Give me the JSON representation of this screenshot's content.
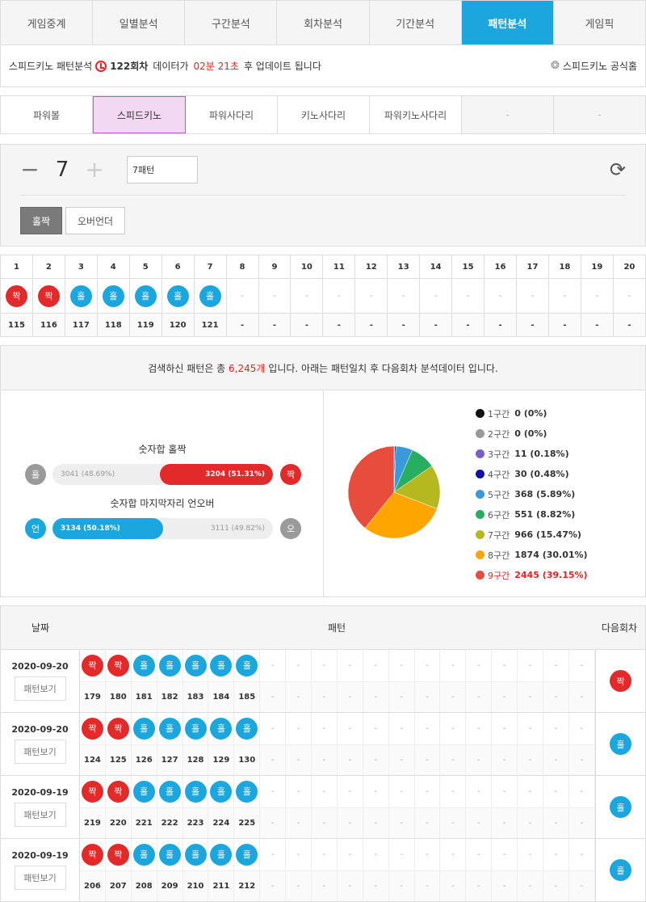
{
  "top_tabs": [
    "게임중계",
    "일별분석",
    "구간분석",
    "회차분석",
    "기간분석",
    "패턴분석",
    "게임픽"
  ],
  "top_tab_active": 5,
  "info": {
    "title": "스피드키노 패턴분석",
    "round": "122회차",
    "text1": "데이터가",
    "countdown": "02분 21초",
    "text2": "후 업데이트 됩니다",
    "link": "스피드키노 공식홈"
  },
  "sub_tabs": [
    "파워볼",
    "스피드키노",
    "파워사다리",
    "키노사다리",
    "파워키노사다리",
    "-",
    "-"
  ],
  "sub_tab_active": 1,
  "control": {
    "minus": "−",
    "count": "7",
    "plus": "+",
    "pattern_value": "7패턴",
    "btn_oddeven": "홀짝",
    "btn_overunder": "오버언더"
  },
  "grid": {
    "headers": [
      "1",
      "2",
      "3",
      "4",
      "5",
      "6",
      "7",
      "8",
      "9",
      "10",
      "11",
      "12",
      "13",
      "14",
      "15",
      "16",
      "17",
      "18",
      "19",
      "20"
    ],
    "balls": [
      "짝",
      "짝",
      "홀",
      "홀",
      "홀",
      "홀",
      "홀",
      "-",
      "-",
      "-",
      "-",
      "-",
      "-",
      "-",
      "-",
      "-",
      "-",
      "-",
      "-",
      "-"
    ],
    "rounds": [
      "115",
      "116",
      "117",
      "118",
      "119",
      "120",
      "121",
      "-",
      "-",
      "-",
      "-",
      "-",
      "-",
      "-",
      "-",
      "-",
      "-",
      "-",
      "-",
      "-"
    ]
  },
  "summary": {
    "pre": "검색하신 패턴은 총",
    "count": "6,245개",
    "post": "입니다. 아래는 패턴일치 후 다음회차 분석데이터 입니다."
  },
  "oddeven": {
    "title": "숫자합 홀짝",
    "left_ball": "홀",
    "right_ball": "짝",
    "left_label": "3041 (48.69%)",
    "right_label": "3204 (51.31%)",
    "left_fraction": 0.4869,
    "right_fraction": 0.5131
  },
  "overunder": {
    "title": "숫자합 마지막자리 언오버",
    "left_ball": "언",
    "right_ball": "오",
    "left_label": "3134 (50.18%)",
    "right_label": "3111 (49.82%)",
    "left_fraction": 0.5018,
    "right_fraction": 0.4982
  },
  "chart_data": {
    "type": "pie",
    "categories": [
      "1구간",
      "2구간",
      "3구간",
      "4구간",
      "5구간",
      "6구간",
      "7구간",
      "8구간",
      "9구간"
    ],
    "values": [
      0,
      0,
      11,
      30,
      368,
      551,
      966,
      1874,
      2445
    ],
    "labels": [
      "0 (0%)",
      "0 (0%)",
      "11 (0.18%)",
      "30 (0.48%)",
      "368 (5.89%)",
      "551 (8.82%)",
      "966 (15.47%)",
      "1874 (30.01%)",
      "2445 (39.15%)"
    ],
    "colors": [
      "#111111",
      "#999999",
      "#7b5fc6",
      "#1111aa",
      "#3a9ad9",
      "#27ae60",
      "#b5b81e",
      "#ffa500",
      "#e74c3c"
    ],
    "highlight": 8
  },
  "history": {
    "head": {
      "date": "날짜",
      "pattern": "패턴",
      "next": "다음회차"
    },
    "view_label": "패턴보기",
    "rows": [
      {
        "date": "2020-09-20",
        "balls": [
          "짝",
          "짝",
          "홀",
          "홀",
          "홀",
          "홀",
          "홀"
        ],
        "rounds": [
          "179",
          "180",
          "181",
          "182",
          "183",
          "184",
          "185"
        ],
        "next": "짝"
      },
      {
        "date": "2020-09-20",
        "balls": [
          "짝",
          "짝",
          "홀",
          "홀",
          "홀",
          "홀",
          "홀"
        ],
        "rounds": [
          "124",
          "125",
          "126",
          "127",
          "128",
          "129",
          "130"
        ],
        "next": "홀"
      },
      {
        "date": "2020-09-19",
        "balls": [
          "짝",
          "짝",
          "홀",
          "홀",
          "홀",
          "홀",
          "홀"
        ],
        "rounds": [
          "219",
          "220",
          "221",
          "222",
          "223",
          "224",
          "225"
        ],
        "next": "홀"
      },
      {
        "date": "2020-09-19",
        "balls": [
          "짝",
          "짝",
          "홀",
          "홀",
          "홀",
          "홀",
          "홀"
        ],
        "rounds": [
          "206",
          "207",
          "208",
          "209",
          "210",
          "211",
          "212"
        ],
        "next": "홀"
      }
    ],
    "empty_cell": "-"
  },
  "colors": {
    "accent": "#1ba6dd",
    "red": "#e22a2a",
    "blue": "#1ba6dd"
  }
}
